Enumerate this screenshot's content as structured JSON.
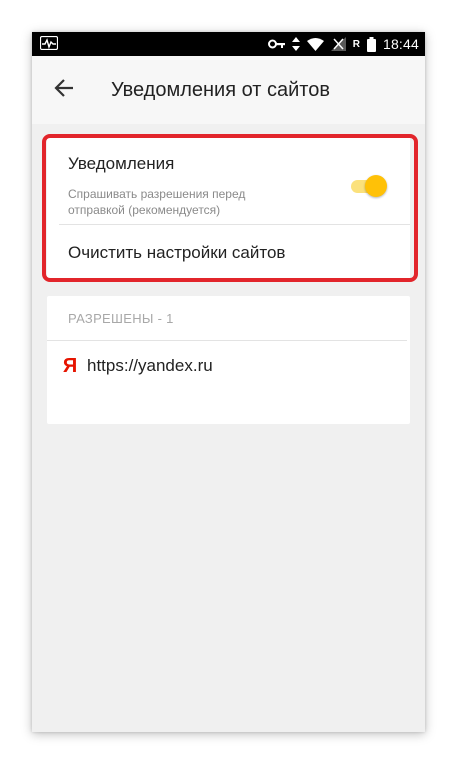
{
  "status_bar": {
    "time": "18:44",
    "network_label": "R"
  },
  "app_bar": {
    "title": "Уведомления от сайтов"
  },
  "settings": {
    "notifications": {
      "title": "Уведомления",
      "subtitle": "Спрашивать разрешения перед отправкой (рекомендуется)",
      "enabled": true
    },
    "clear_label": "Очистить настройки сайтов"
  },
  "allowed": {
    "header": "РАЗРЕШЕНЫ - 1",
    "sites": [
      {
        "icon": "Я",
        "url": "https://yandex.ru"
      }
    ]
  },
  "colors": {
    "accent": "#ffc107",
    "toggle_track": "#fbe17c",
    "highlight": "#e2252b",
    "yandex": "#e61400"
  }
}
